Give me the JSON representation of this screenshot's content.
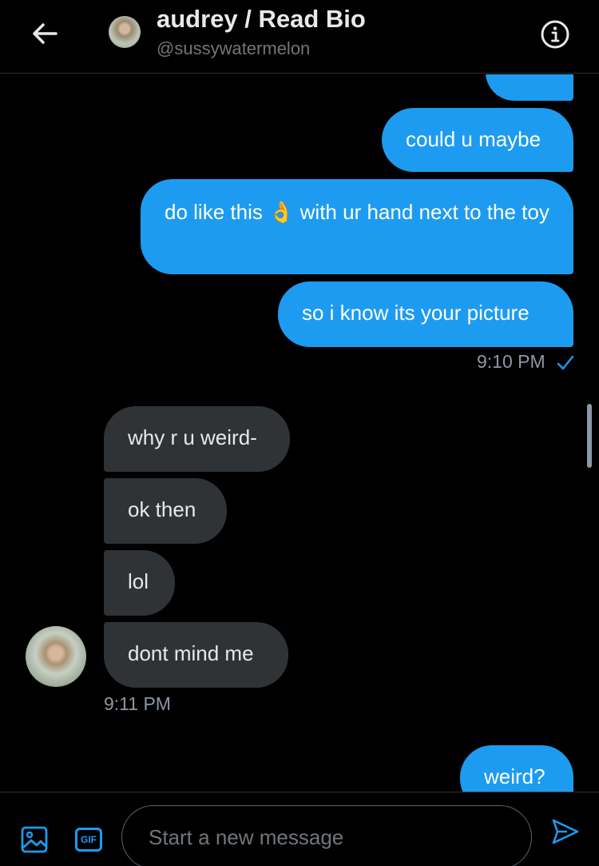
{
  "header": {
    "title": "audrey / Read Bio",
    "handle": "@sussywatermelon",
    "back_icon": "arrow-left-icon",
    "info_icon": "info-icon"
  },
  "messages": {
    "sent_group": [
      {
        "text": "could u maybe"
      },
      {
        "text": "do like this 👌 with ur hand next to the toy"
      },
      {
        "text": "so i know its your picture"
      }
    ],
    "sent_timestamp": "9:10 PM",
    "received_group": [
      {
        "text": "why r u weird-"
      },
      {
        "text": "ok then"
      },
      {
        "text": "lol"
      },
      {
        "text": "dont mind me"
      }
    ],
    "received_timestamp": "9:11 PM",
    "last_sent": {
      "text": "weird?"
    }
  },
  "composer": {
    "placeholder": "Start a new message",
    "gif_label": "GIF",
    "media_icon": "image-icon",
    "send_icon": "send-icon"
  },
  "colors": {
    "accent": "#1d9bf0",
    "received_bubble": "#2f3336",
    "background": "#000000"
  }
}
